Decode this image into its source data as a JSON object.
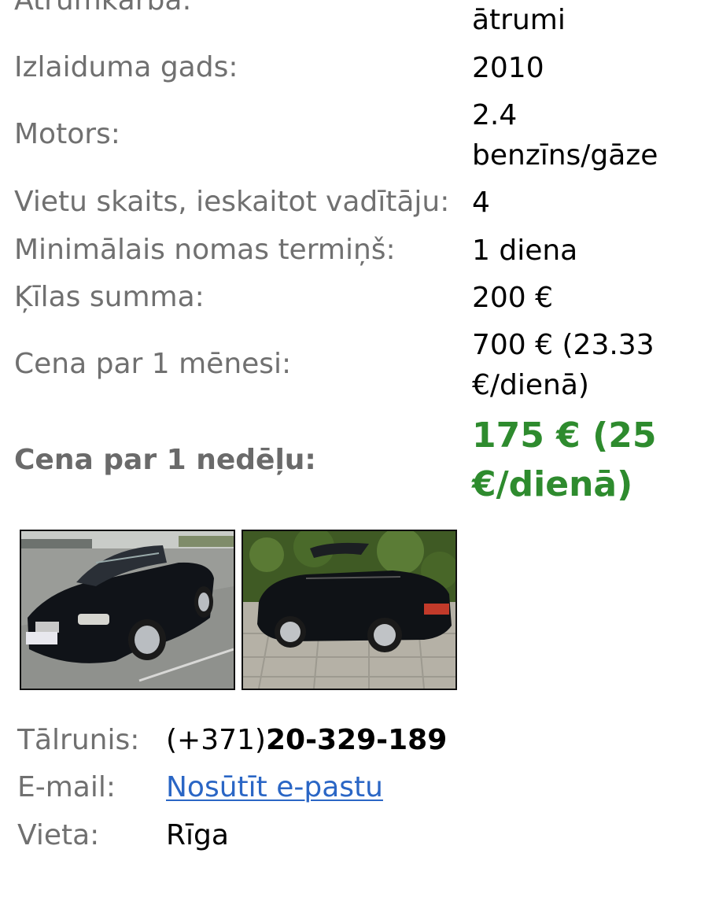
{
  "specs": {
    "gearbox_label": "Ātrumkārba:",
    "gearbox_value": "ātrumi",
    "year_label": "Izlaiduma gads:",
    "year_value": "2010",
    "engine_label": "Motors:",
    "engine_value_line1": "2.4",
    "engine_value_line2": "benzīns/gāze",
    "seats_label": "Vietu skaits, ieskaitot vadītāju:",
    "seats_value": "4",
    "min_term_label": "Minimālais nomas termiņš:",
    "min_term_value": "1 diena",
    "deposit_label": "Ķīlas summa:",
    "deposit_value": "200 €",
    "month_label": "Cena par 1 mēnesi:",
    "month_value_line1": "700 € (23.33",
    "month_value_line2": "€/dienā)",
    "week_label": "Cena par 1 nedēļu:",
    "week_value_line1": "175 € (25",
    "week_value_line2": "€/dienā)"
  },
  "colors": {
    "label": "#707070",
    "price_green": "#2e8b2e",
    "link": "#2a66c5"
  },
  "contact": {
    "phone_label": "Tālrunis:",
    "phone_prefix": "(+371)",
    "phone_number": "20-329-189",
    "email_label": "E-mail:",
    "email_link": "Nosūtīt e-pastu",
    "location_label": "Vieta:",
    "location_value": "Rīga"
  }
}
